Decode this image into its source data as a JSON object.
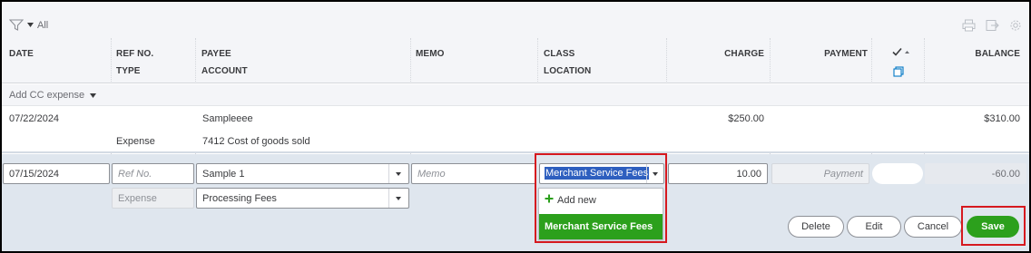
{
  "toolbar": {
    "filter_label": "All",
    "icons": [
      "filter-icon",
      "print-icon",
      "export-icon",
      "settings-icon"
    ]
  },
  "columns": {
    "date": "DATE",
    "ref_no": "REF NO.",
    "type": "TYPE",
    "payee": "PAYEE",
    "account": "ACCOUNT",
    "memo": "MEMO",
    "class": "CLASS",
    "location": "LOCATION",
    "charge": "CHARGE",
    "payment": "PAYMENT",
    "balance": "BALANCE"
  },
  "add_row": {
    "label": "Add CC expense"
  },
  "rows": [
    {
      "date": "07/22/2024",
      "ref_no": "",
      "type": "Expense",
      "payee": "Sampleeee",
      "account": "7412 Cost of goods sold",
      "memo": "",
      "class": "",
      "charge": "$250.00",
      "payment": "",
      "balance": "$310.00"
    }
  ],
  "edit_row": {
    "date": "07/15/2024",
    "ref_no_placeholder": "Ref No.",
    "type": "Expense",
    "payee": "Sample 1",
    "account": "Processing Fees",
    "memo_placeholder": "Memo",
    "class": "Merchant Service Fees",
    "charge": "10.00",
    "payment_placeholder": "Payment",
    "balance": "-60.00"
  },
  "class_menu": {
    "add_new": "Add new",
    "options": [
      "Merchant Service Fees"
    ]
  },
  "actions": {
    "delete": "Delete",
    "edit": "Edit",
    "cancel": "Cancel",
    "save": "Save"
  },
  "colors": {
    "accent_green": "#2ca01c",
    "highlight_red": "#d6191f",
    "selection_blue": "#2e5fbf"
  }
}
